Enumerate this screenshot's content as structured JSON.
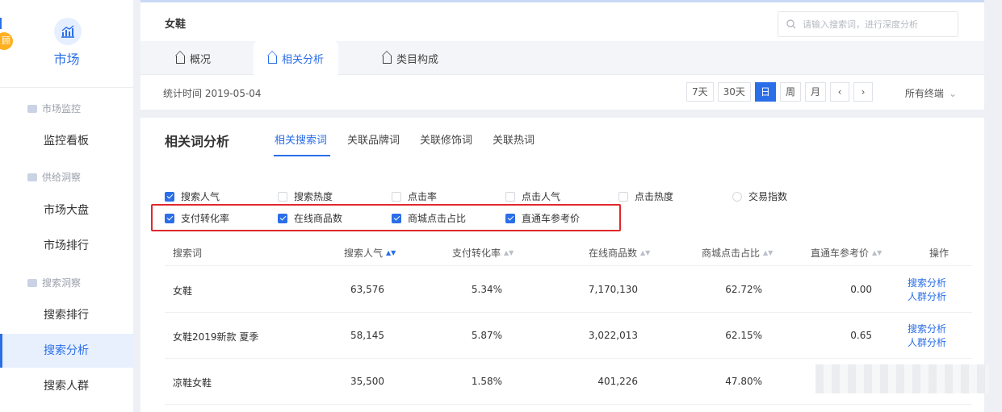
{
  "sidebar": {
    "badge": "顾",
    "title": "市场",
    "groups": [
      {
        "label": "市场监控",
        "items": [
          "监控看板"
        ]
      },
      {
        "label": "供给洞察",
        "items": [
          "市场大盘",
          "市场排行"
        ]
      },
      {
        "label": "搜索洞察",
        "items": [
          "搜索排行",
          "搜索分析",
          "搜索人群"
        ]
      }
    ]
  },
  "top": {
    "title": "女鞋",
    "search_placeholder": "请输入搜索词，进行深度分析",
    "tabs": [
      "概况",
      "相关分析",
      "类目构成"
    ],
    "active_tab": 1,
    "stat_time": "统计时间 2019-05-04",
    "periods": [
      "7天",
      "30天",
      "日",
      "周",
      "月"
    ],
    "active_period": 2,
    "prev": "‹",
    "next": "›",
    "all_terms": "所有终端",
    "dropdown_icon": "⌄"
  },
  "analysis": {
    "title": "相关词分析",
    "subtabs": [
      "相关搜索词",
      "关联品牌词",
      "关联修饰词",
      "关联热词"
    ],
    "active_subtab": 0,
    "metrics_row1": [
      {
        "label": "搜索人气",
        "checked": true
      },
      {
        "label": "搜索热度",
        "checked": false
      },
      {
        "label": "点击率",
        "checked": false
      },
      {
        "label": "点击人气",
        "checked": false
      },
      {
        "label": "点击热度",
        "checked": false
      },
      {
        "label": "交易指数",
        "checked": false
      }
    ],
    "metrics_row2": [
      {
        "label": "支付转化率",
        "checked": true
      },
      {
        "label": "在线商品数",
        "checked": true
      },
      {
        "label": "商城点击占比",
        "checked": true
      },
      {
        "label": "直通车参考价",
        "checked": true
      }
    ],
    "columns": [
      "搜索词",
      "搜索人气",
      "支付转化率",
      "在线商品数",
      "商城点击占比",
      "直通车参考价",
      "操作"
    ],
    "rows": [
      {
        "term": "女鞋",
        "popularity": "63,576",
        "conversion": "5.34%",
        "products": "7,170,130",
        "mall_ratio": "62.72%",
        "price": "0.00",
        "op1": "搜索分析",
        "op2": "人群分析"
      },
      {
        "term": "女鞋2019新款 夏季",
        "popularity": "58,145",
        "conversion": "5.87%",
        "products": "3,022,013",
        "mall_ratio": "62.15%",
        "price": "0.65",
        "op1": "搜索分析",
        "op2": "人群分析"
      },
      {
        "term": "凉鞋女鞋",
        "popularity": "35,500",
        "conversion": "1.58%",
        "products": "401,226",
        "mall_ratio": "47.80%",
        "price": "",
        "op1": "",
        "op2": ""
      }
    ]
  },
  "colors": {
    "accent": "#2a6ee8",
    "highlight": "#e0282e"
  },
  "icons": {
    "market": "market-chart-icon",
    "search": "search-icon",
    "tab": "home-icon",
    "group": "folder-icon"
  }
}
